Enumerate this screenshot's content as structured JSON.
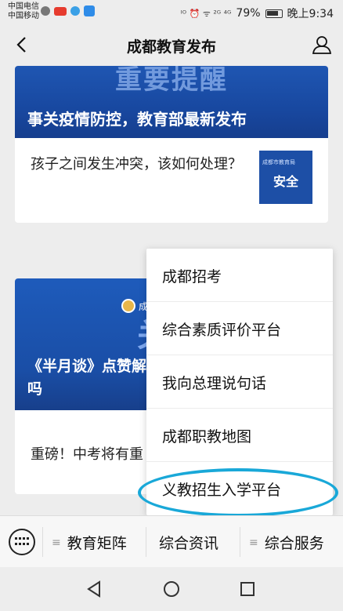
{
  "status_bar": {
    "carrier_line1": "中国电信",
    "carrier_line2": "中国移动",
    "network_icons": "ᴵᴼ ⏰ ᯤ ²ᴳ ⁴ᴳ",
    "battery_percent": "79%",
    "time": "晚上9:34"
  },
  "header": {
    "title": "成都教育发布"
  },
  "feed": {
    "card1": {
      "banner_big_text": "重要提醒",
      "banner_caption": "事关疫情防控，教育部最新发布",
      "item_text": "孩子之间发生冲突，该如何处理？",
      "thumb_small": "成都市教育局",
      "thumb_big": "安全"
    },
    "card2": {
      "logo_text": "成",
      "banner_big_text": "关",
      "banner_caption": "《半月谈》点赞解吗",
      "item_text": "重磅！中考将有重"
    }
  },
  "menu": {
    "items": [
      "成都招考",
      "综合素质评价平台",
      "我向总理说句话",
      "成都职教地图",
      "义教招生入学平台"
    ]
  },
  "bottom_menu": {
    "tabs": [
      "教育矩阵",
      "综合资讯",
      "综合服务"
    ]
  },
  "colors": {
    "accent_highlight": "#19a8d8",
    "banner_blue": "#1d4fa6"
  }
}
